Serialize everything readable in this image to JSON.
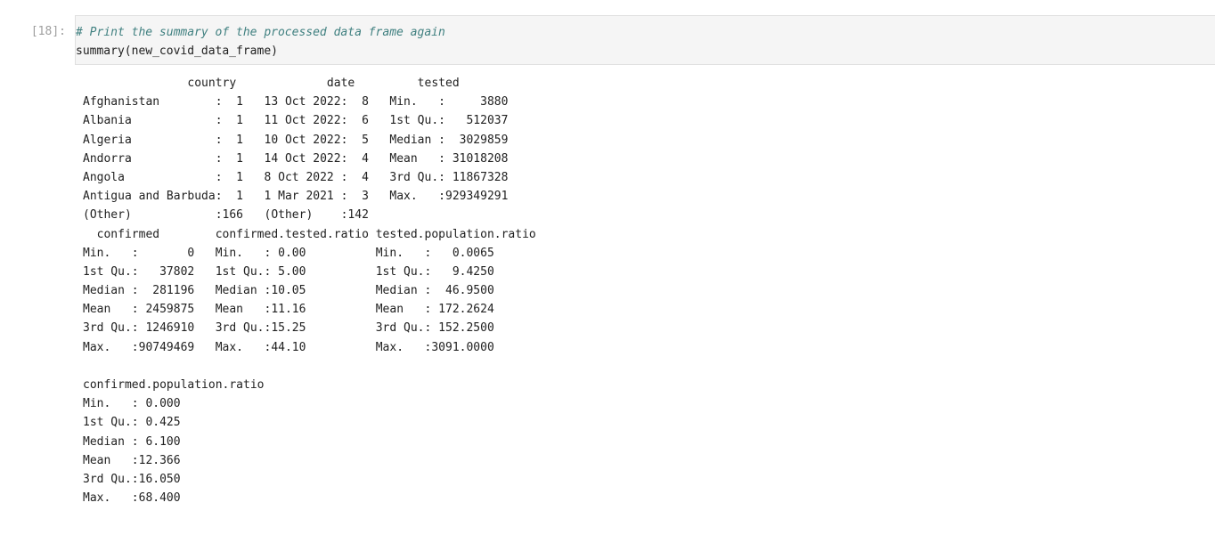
{
  "cell": {
    "prompt": "[18]:",
    "code": {
      "comment": "# Print the summary of the processed data frame again",
      "call": "summary(new_covid_data_frame)"
    }
  },
  "output": {
    "lines": [
      "               country             date         tested       ",
      "Afghanistan        :  1   13 Oct 2022:  8   Min.   :     3880  ",
      "Albania            :  1   11 Oct 2022:  6   1st Qu.:   512037  ",
      "Algeria            :  1   10 Oct 2022:  5   Median :  3029859  ",
      "Andorra            :  1   14 Oct 2022:  4   Mean   : 31018208  ",
      "Angola             :  1   8 Oct 2022 :  4   3rd Qu.: 11867328  ",
      "Antigua and Barbuda:  1   1 Mar 2021 :  3   Max.   :929349291  ",
      "(Other)            :166   (Other)    :142                      ",
      "  confirmed        confirmed.tested.ratio tested.population.ratio",
      "Min.   :       0   Min.   : 0.00          Min.   :   0.0065      ",
      "1st Qu.:   37802   1st Qu.: 5.00          1st Qu.:   9.4250      ",
      "Median :  281196   Median :10.05          Median :  46.9500      ",
      "Mean   : 2459875   Mean   :11.16          Mean   : 172.2624      ",
      "3rd Qu.: 1246910   3rd Qu.:15.25          3rd Qu.: 152.2500      ",
      "Max.   :90749469   Max.   :44.10          Max.   :3091.0000      ",
      "",
      "confirmed.population.ratio",
      "Min.   : 0.000            ",
      "1st Qu.: 0.425            ",
      "Median : 6.100            ",
      "Mean   :12.366            ",
      "3rd Qu.:16.050            ",
      "Max.   :68.400            "
    ]
  }
}
